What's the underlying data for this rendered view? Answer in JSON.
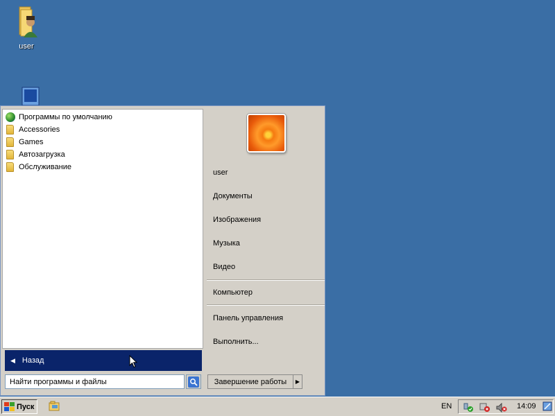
{
  "desktop": {
    "icons": [
      {
        "label": "user"
      }
    ]
  },
  "start_menu": {
    "programs": [
      {
        "label": "Программы по умолчанию",
        "icon": "default-programs-icon"
      },
      {
        "label": "Accessories",
        "icon": "folder-icon"
      },
      {
        "label": "Games",
        "icon": "folder-icon"
      },
      {
        "label": "Автозагрузка",
        "icon": "folder-icon"
      },
      {
        "label": "Обслуживание",
        "icon": "folder-icon"
      }
    ],
    "back_label": "Назад",
    "search_placeholder": "Найти программы и файлы",
    "right": {
      "user": "user",
      "documents": "Документы",
      "pictures": "Изображения",
      "music": "Музыка",
      "video": "Видео",
      "computer": "Компьютер",
      "control_panel": "Панель управления",
      "run": "Выполнить..."
    },
    "shutdown_label": "Завершение работы"
  },
  "taskbar": {
    "start_label": "Пуск",
    "language": "EN",
    "clock": "14:09"
  },
  "colors": {
    "desktop": "#3a6ea5",
    "selection": "#0a246a"
  }
}
